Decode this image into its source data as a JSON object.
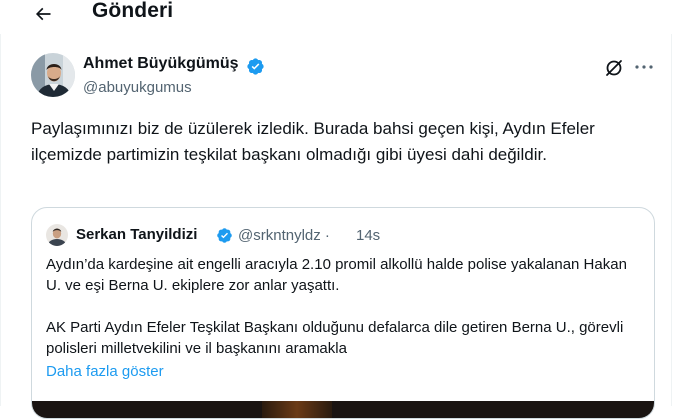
{
  "header": {
    "title": "Gönderi",
    "back_icon": "arrow-left-icon"
  },
  "post": {
    "author_name": "Ahmet Büyükgümüş",
    "author_handle": "@abuyukgumus",
    "verified_color": "#1d9bf0",
    "text": "Paylaşımınızı biz de üzülerek izledik. Burada bahsi geçen kişi, Aydın Efeler ilçemizde partimizin teşkilat başkanı olmadığı gibi üyesi dahi değildir.",
    "grok_icon": "grok-icon",
    "more_icon": "more-horizontal-icon"
  },
  "quote": {
    "author_name": "Serkan Tanyildizi",
    "author_handle": "@srkntnyldz",
    "separator": "·",
    "time": "14s",
    "text": "Aydın’da kardeşine ait engelli aracıyla 2.10 promil alkollü halde polise yakalanan Hakan U. ve eşi Berna U. ekiplere zor anlar yaşattı.\n\nAK Parti Aydın Efeler Teşkilat Başkanı olduğunu defalarca dile getiren Berna U., görevli polisleri milletvekilini ve il başkanını aramakla",
    "show_more": "Daha fazla göster"
  },
  "colors": {
    "accent": "#1d9bf0",
    "text": "#0f1419",
    "secondary": "#536471",
    "border": "#cfd9de"
  }
}
